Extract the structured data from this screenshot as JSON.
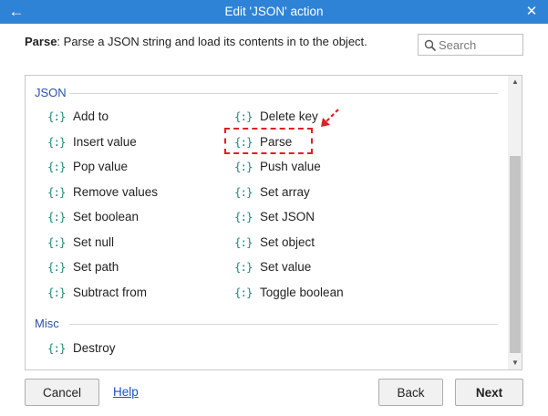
{
  "window": {
    "title": "Edit 'JSON' action"
  },
  "description": {
    "action_name": "Parse",
    "text": ": Parse a JSON string and load its contents in to the object."
  },
  "search": {
    "placeholder": "Search",
    "value": ""
  },
  "sections": [
    {
      "header": "JSON",
      "items": [
        "Add to",
        "Delete key",
        "Insert value",
        "Parse",
        "Pop value",
        "Push value",
        "Remove values",
        "Set array",
        "Set boolean",
        "Set JSON",
        "Set null",
        "Set object",
        "Set path",
        "Set value",
        "Subtract from",
        "Toggle boolean"
      ]
    },
    {
      "header": "Misc",
      "items": [
        "Destroy"
      ]
    }
  ],
  "item_icon": "{:}",
  "highlighted_item": "Parse",
  "footer": {
    "cancel_label": "Cancel",
    "help_label": "Help",
    "back_label": "Back",
    "next_label": "Next"
  },
  "colors": {
    "titlebar": "#2f83d6",
    "section_header": "#2a52a8",
    "icon": "#1f8a7a",
    "highlight": "#e01f26",
    "link": "#1a53c2"
  }
}
